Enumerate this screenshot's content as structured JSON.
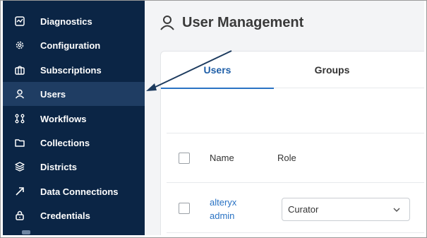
{
  "sidebar": {
    "items": [
      {
        "label": "Diagnostics",
        "icon": "diagnostics-icon",
        "active": false
      },
      {
        "label": "Configuration",
        "icon": "gear-icon",
        "active": false
      },
      {
        "label": "Subscriptions",
        "icon": "subscriptions-icon",
        "active": false
      },
      {
        "label": "Users",
        "icon": "user-icon",
        "active": true
      },
      {
        "label": "Workflows",
        "icon": "workflow-icon",
        "active": false
      },
      {
        "label": "Collections",
        "icon": "folder-icon",
        "active": false
      },
      {
        "label": "Districts",
        "icon": "layers-icon",
        "active": false
      },
      {
        "label": "Data Connections",
        "icon": "data-connection-icon",
        "active": false
      },
      {
        "label": "Credentials",
        "icon": "lock-icon",
        "active": false
      }
    ]
  },
  "page": {
    "title": "User Management",
    "title_icon": "user-icon"
  },
  "tabs": [
    {
      "label": "Users",
      "active": true
    },
    {
      "label": "Groups",
      "active": false
    }
  ],
  "table": {
    "headers": {
      "name": "Name",
      "role": "Role"
    },
    "rows": [
      {
        "name": "alteryx admin",
        "role": "Curator"
      }
    ]
  },
  "colors": {
    "sidebar_bg": "#0b2545",
    "sidebar_active": "#1f3d63",
    "accent": "#2a73c4",
    "annotation_arrow": "#1c3a5e"
  }
}
